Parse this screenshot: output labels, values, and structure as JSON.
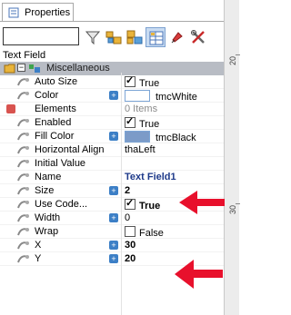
{
  "panel": {
    "tab_label": "Properties",
    "object_label": "Text Field"
  },
  "search": {
    "value": ""
  },
  "toolbar": {
    "buttons": [
      {
        "name": "filter-icon"
      },
      {
        "name": "category-icon"
      },
      {
        "name": "sort-icon"
      },
      {
        "name": "grid-view-icon"
      },
      {
        "name": "pin-icon"
      },
      {
        "name": "tools-icon"
      }
    ]
  },
  "category": {
    "label": "Miscellaneous"
  },
  "properties": [
    {
      "name": "Auto Size",
      "value": "True",
      "checkbox": true,
      "checked": true
    },
    {
      "name": "Color",
      "value": "tmcWhite",
      "swatch": "#ffffff",
      "plus": true
    },
    {
      "name": "Elements",
      "value": "0 Items",
      "grey": true
    },
    {
      "name": "Enabled",
      "value": "True",
      "checkbox": true,
      "checked": true
    },
    {
      "name": "Fill Color",
      "value": "tmcBlack",
      "swatch": "#7c9bc8",
      "plus": true
    },
    {
      "name": "Horizontal Align",
      "value": "thaLeft"
    },
    {
      "name": "Initial Value",
      "value": ""
    },
    {
      "name": "Name",
      "value": "Text Field1",
      "bold": true,
      "blue": true
    },
    {
      "name": "Size",
      "value": "2",
      "bold": true,
      "plus": true
    },
    {
      "name": "Use Code...",
      "value": "True",
      "checkbox": true,
      "checked": true,
      "bold": true
    },
    {
      "name": "Width",
      "value": "0",
      "plus": true
    },
    {
      "name": "Wrap",
      "value": "False",
      "checkbox": true,
      "checked": false
    },
    {
      "name": "X",
      "value": "30",
      "bold": true,
      "plus": true
    },
    {
      "name": "Y",
      "value": "20",
      "bold": true,
      "plus": true
    }
  ],
  "ruler": {
    "ticks": [
      "20",
      "30"
    ]
  },
  "colors": {
    "arrow": "#e8102c",
    "category_bg": "#b8bcc4"
  }
}
